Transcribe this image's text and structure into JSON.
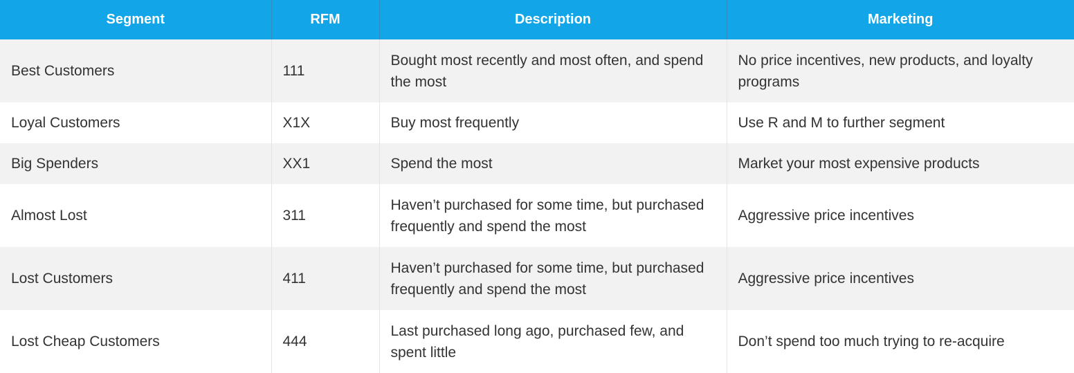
{
  "headers": {
    "segment": "Segment",
    "rfm": "RFM",
    "description": "Description",
    "marketing": "Marketing"
  },
  "rows": [
    {
      "segment": "Best Customers",
      "rfm": "111",
      "description": "Bought most recently and most often, and spend the most",
      "marketing": "No price incentives, new products, and loyalty programs"
    },
    {
      "segment": "Loyal Customers",
      "rfm": "X1X",
      "description": "Buy most frequently",
      "marketing": "Use R and M to further segment"
    },
    {
      "segment": "Big Spenders",
      "rfm": "XX1",
      "description": "Spend the most",
      "marketing": "Market your most expensive products"
    },
    {
      "segment": "Almost Lost",
      "rfm": "311",
      "description": "Haven’t purchased for some time, but purchased frequently and spend the most",
      "marketing": "Aggressive price incentives"
    },
    {
      "segment": "Lost Customers",
      "rfm": "411",
      "description": "Haven’t purchased for some time, but purchased frequently and spend the most",
      "marketing": "Aggressive price incentives"
    },
    {
      "segment": "Lost Cheap Customers",
      "rfm": "444",
      "description": "Last purchased long ago, purchased few, and spent little",
      "marketing": "Don’t spend too much trying to re-acquire"
    }
  ]
}
